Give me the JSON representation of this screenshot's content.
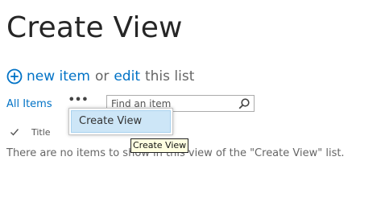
{
  "page": {
    "title": "Create View"
  },
  "actions": {
    "new_item_label": "new item",
    "or_text": "or",
    "edit_label": "edit",
    "this_list_text": "this list"
  },
  "views": {
    "current_view": "All Items",
    "more_label": "•••"
  },
  "search": {
    "placeholder": "Find an item"
  },
  "list_header": {
    "columns": [
      "Title"
    ]
  },
  "list": {
    "empty_message": "There are no items to show in this view of the \"Create View\" list."
  },
  "dropdown": {
    "items": [
      {
        "label": "Create View"
      }
    ]
  },
  "tooltip": {
    "text": "Create View"
  },
  "colors": {
    "link": "#0072c6",
    "menu_highlight": "#cde6f7",
    "tooltip_bg": "#ffffe1"
  }
}
